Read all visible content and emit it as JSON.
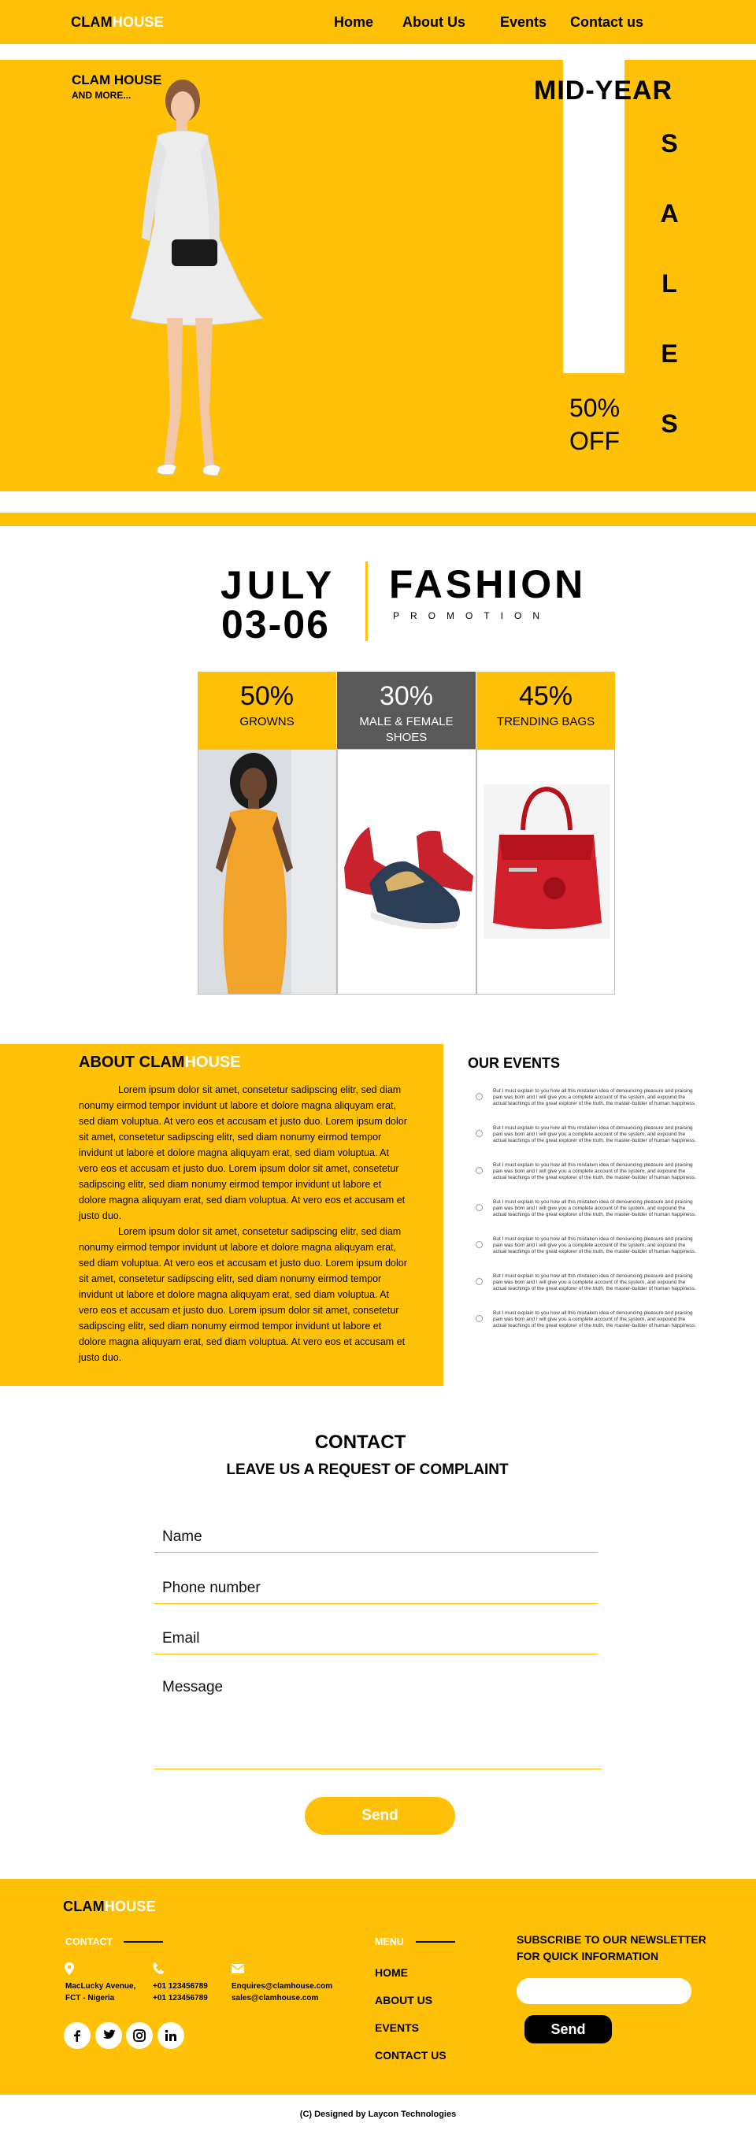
{
  "brand": {
    "dark": "CLAM",
    "light": "HOUSE"
  },
  "nav": {
    "home": "Home",
    "about": "About Us",
    "events": "Events",
    "contact": "Contact us"
  },
  "hero": {
    "brand": "CLAM HOUSE",
    "tagline": "AND MORE...",
    "headline": "MID-YEAR",
    "sales_letters": [
      "S",
      "A",
      "L",
      "E",
      "S"
    ],
    "discount_pct": "50%",
    "discount_word": "OFF"
  },
  "promo": {
    "month": "JULY",
    "dates": "03-06",
    "title": "FASHION",
    "subtitle": "PROMOTION",
    "cards": [
      {
        "pct": "50%",
        "label": "GROWNS",
        "color": "#ffc107",
        "text_color": "#000000"
      },
      {
        "pct": "30%",
        "label": "MALE & FEMALE SHOES",
        "color": "#595959",
        "text_color": "#ffffff"
      },
      {
        "pct": "45%",
        "label": "TRENDING BAGS",
        "color": "#ffc107",
        "text_color": "#000000"
      }
    ]
  },
  "about": {
    "title_dark": "ABOUT CLAM",
    "title_light": "HOUSE",
    "p1": "Lorem ipsum dolor sit amet, consetetur sadipscing elitr, sed diam nonumy eirmod tempor invidunt ut labore et dolore magna aliquyam erat, sed diam voluptua. At vero eos et accusam et justo duo. Lorem ipsum dolor sit amet, consetetur sadipscing elitr, sed diam nonumy eirmod tempor invidunt ut labore et dolore magna aliquyam erat, sed diam voluptua. At vero eos et accusam et justo duo. Lorem ipsum dolor sit amet, consetetur sadipscing elitr, sed diam nonumy eirmod tempor invidunt ut labore et dolore magna aliquyam erat, sed diam voluptua. At vero eos et accusam et justo duo.",
    "p2": "Lorem ipsum dolor sit amet, consetetur sadipscing elitr, sed diam nonumy eirmod tempor invidunt ut labore et dolore magna aliquyam erat, sed diam voluptua. At vero eos et accusam et justo duo. Lorem ipsum dolor sit amet, consetetur sadipscing elitr, sed diam nonumy eirmod tempor invidunt ut labore et dolore magna aliquyam erat, sed diam voluptua. At vero eos et accusam et justo duo. Lorem ipsum dolor sit amet, consetetur sadipscing elitr, sed diam nonumy eirmod tempor invidunt ut labore et dolore magna aliquyam erat, sed diam voluptua. At vero eos et accusam et justo duo."
  },
  "events": {
    "title": "OUR EVENTS",
    "items": [
      "But I must explain to you how all this mistaken idea of denouncing pleasure and praising pain was born and I will give you a complete account of the system, and expound the actual teachings of the great explorer of the truth, the master-builder of human happiness.",
      "But I must explain to you how all this mistaken idea of denouncing pleasure and praising pain was born and I will give you a complete account of the system, and expound the actual teachings of the great explorer of the truth, the master-builder of human happiness.",
      "But I must explain to you how all this mistaken idea of denouncing pleasure and praising pain was born and I will give you a complete account of the system, and expound the actual teachings of the great explorer of the truth, the master-builder of human happiness.",
      "But I must explain to you how all this mistaken idea of denouncing pleasure and praising pain was born and I will give you a complete account of the system, and expound the actual teachings of the great explorer of the truth, the master-builder of human happiness.",
      "But I must explain to you how all this mistaken idea of denouncing pleasure and praising pain was born and I will give you a complete account of the system, and expound the actual teachings of the great explorer of the truth, the master-builder of human happiness.",
      "But I must explain to you how all this mistaken idea of denouncing pleasure and praising pain was born and I will give you a complete account of the system, and expound the actual teachings of the great explorer of the truth, the master-builder of human happiness.",
      "But I must explain to you how all this mistaken idea of denouncing pleasure and praising pain was born and I will give you a complete account of the system, and expound the actual teachings of the great explorer of the truth, the master-builder of human happiness."
    ]
  },
  "contact": {
    "title": "CONTACT",
    "subtitle": "LEAVE US A REQUEST OF COMPLAINT",
    "name_placeholder": "Name",
    "phone_placeholder": "Phone number",
    "email_placeholder": "Email",
    "message_placeholder": "Message",
    "send_label": "Send"
  },
  "footer": {
    "contact_title": "CONTACT",
    "address_line1": "MacLucky Avenue,",
    "address_line2": "FCT - Nigeria",
    "phone1": "+01 123456789",
    "phone2": "+01 123456789",
    "email1": "Enquires@clamhouse.com",
    "email2": "sales@clamhouse.com",
    "menu_title": "MENU",
    "menu": [
      "HOME",
      "ABOUT US",
      "EVENTS",
      "CONTACT US"
    ],
    "newsletter_line1": "SUBSCRIBE TO OUR NEWSLETTER",
    "newsletter_line2": "FOR QUICK INFORMATION",
    "send_label": "Send",
    "socials": [
      "facebook-icon",
      "twitter-icon",
      "instagram-icon",
      "linkedin-icon"
    ],
    "copyright": "(C) Designed by Laycon Technologies"
  },
  "colors": {
    "accent": "#ffc107",
    "dark_card": "#595959"
  }
}
